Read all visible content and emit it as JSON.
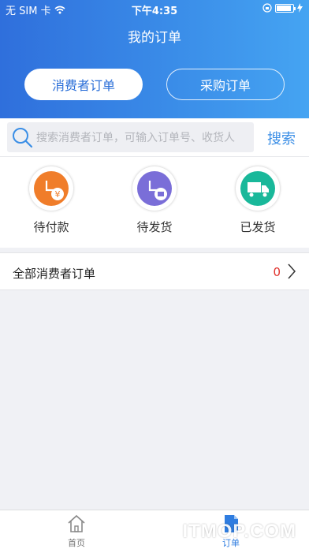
{
  "status_bar": {
    "carrier": "无 SIM 卡",
    "time": "下午4:35"
  },
  "header": {
    "title": "我的订单"
  },
  "tabs": [
    {
      "label": "消费者订单",
      "active": true
    },
    {
      "label": "采购订单",
      "active": false
    }
  ],
  "search": {
    "placeholder": "搜索消费者订单，可输入订单号、收货人",
    "button_label": "搜索"
  },
  "order_status": [
    {
      "label": "待付款",
      "icon": "pending-payment-icon",
      "color": "#f07d2a"
    },
    {
      "label": "待发货",
      "icon": "pending-shipment-icon",
      "color": "#7a6ed8"
    },
    {
      "label": "已发货",
      "icon": "shipped-truck-icon",
      "color": "#19b89a"
    }
  ],
  "all_orders": {
    "label": "全部消费者订单",
    "count": "0"
  },
  "tabbar": [
    {
      "label": "首页",
      "icon": "home-icon"
    },
    {
      "label": "订单",
      "icon": "orders-icon",
      "active": true
    }
  ],
  "watermark": "ITMOP.COM",
  "colors": {
    "accent": "#3a8ee6",
    "header_start": "#2f6fdc",
    "header_end": "#45a4f2",
    "count_red": "#e0332e"
  }
}
